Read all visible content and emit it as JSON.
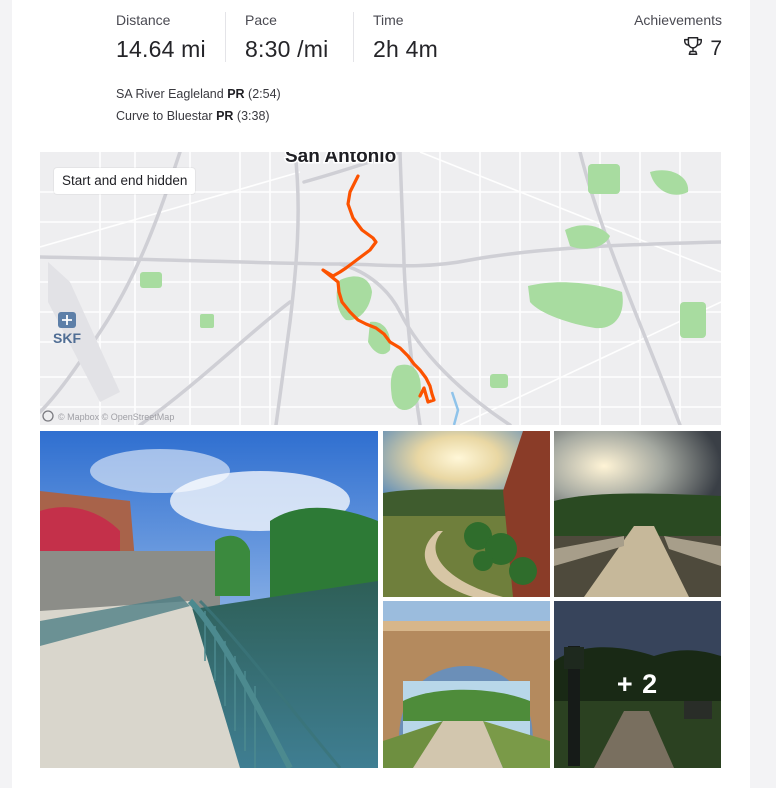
{
  "stats": {
    "distance": {
      "label": "Distance",
      "value": "14.64 mi"
    },
    "pace": {
      "label": "Pace",
      "value": "8:30 /mi"
    },
    "time": {
      "label": "Time",
      "value": "2h 4m"
    },
    "achievements": {
      "label": "Achievements",
      "count": "7",
      "icon": "trophy-icon"
    }
  },
  "segments": [
    {
      "name": "SA River Eagleland",
      "badge": "PR",
      "time": "(2:54)"
    },
    {
      "name": "Curve to Bluestar",
      "badge": "PR",
      "time": "(3:38)"
    }
  ],
  "map": {
    "city_label": "San Antonio",
    "airport_label": "SKF",
    "hidden_notice": "Start and end hidden",
    "attribution": "© Mapbox © OpenStreetMap",
    "route_color": "#fc5200",
    "park_color": "#a8dca0"
  },
  "photos": {
    "more_label": "+ 2",
    "count_visible": 5
  }
}
